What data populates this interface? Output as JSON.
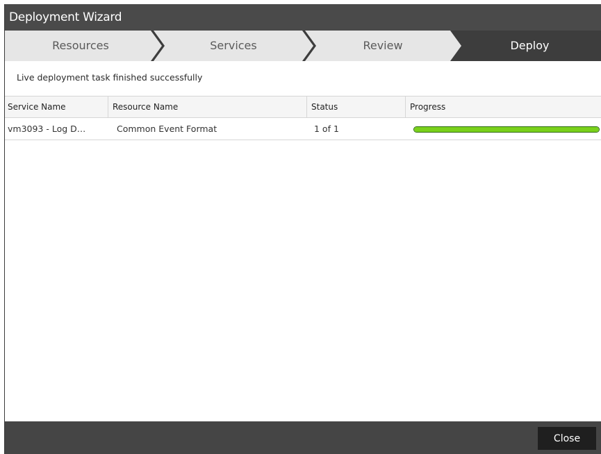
{
  "window": {
    "title": "Deployment Wizard"
  },
  "steps": [
    {
      "label": "Resources",
      "active": false
    },
    {
      "label": "Services",
      "active": false
    },
    {
      "label": "Review",
      "active": false
    },
    {
      "label": "Deploy",
      "active": true
    }
  ],
  "status_message": "Live deployment task finished successfully",
  "table": {
    "columns": [
      "Service Name",
      "Resource Name",
      "Status",
      "Progress"
    ],
    "rows": [
      {
        "service_name": "vm3093 - Log D…",
        "resource_name": "Common Event Format",
        "status": "1 of 1",
        "progress": 1.0
      }
    ]
  },
  "footer": {
    "close_label": "Close"
  },
  "colors": {
    "title_bar": "#4a4a4a",
    "active_step": "#3d3d3d",
    "inactive_step": "#e6e6e6",
    "progress_fill": "#7ad11b",
    "footer": "#454545",
    "close_button": "#1f1f1f"
  }
}
